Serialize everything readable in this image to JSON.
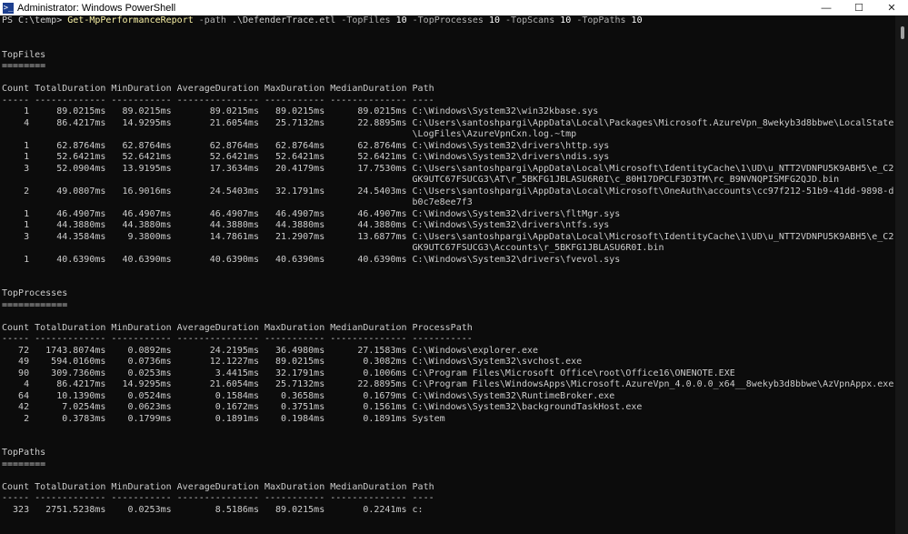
{
  "window": {
    "title": "Administrator: Windows PowerShell",
    "icon": "powershell-icon",
    "controls": {
      "minimize": "—",
      "maximize": "☐",
      "close": "✕"
    }
  },
  "prompt": {
    "path": "PS C:\\temp>",
    "command": "Get-MpPerformanceReport",
    "args": [
      {
        "param": "-path",
        "value": ".\\DefenderTrace.etl"
      },
      {
        "param": "-TopFiles",
        "value": "10"
      },
      {
        "param": "-TopProcesses",
        "value": "10"
      },
      {
        "param": "-TopScans",
        "value": "10"
      },
      {
        "param": "-TopPaths",
        "value": "10"
      }
    ]
  },
  "lines": [
    "",
    "",
    "TopFiles",
    "========",
    "",
    "Count TotalDuration MinDuration AverageDuration MaxDuration MedianDuration Path",
    "----- ------------- ----------- --------------- ----------- -------------- ----",
    "    1     89.0215ms   89.0215ms       89.0215ms   89.0215ms      89.0215ms C:\\Windows\\System32\\win32kbase.sys",
    "    4     86.4217ms   14.9295ms       21.6054ms   25.7132ms      22.8895ms C:\\Users\\santoshpargi\\AppData\\Local\\Packages\\Microsoft.AzureVpn_8wekyb3d8bbwe\\LocalState",
    "                                                                           \\LogFiles\\AzureVpnCxn.log.~tmp",
    "    1     62.8764ms   62.8764ms       62.8764ms   62.8764ms      62.8764ms C:\\Windows\\System32\\drivers\\http.sys",
    "    1     52.6421ms   52.6421ms       52.6421ms   52.6421ms      52.6421ms C:\\Windows\\System32\\drivers\\ndis.sys",
    "    3     52.0904ms   13.9195ms       17.3634ms   20.4179ms      17.7530ms C:\\Users\\santoshpargi\\AppData\\Local\\Microsoft\\IdentityCache\\1\\UD\\u_NTT2VDNPU5K9ABH5\\e_C2",
    "                                                                           GK9UTC67FSUCG3\\AT\\r_5BKFG1JBLASU6R0I\\c_80H17DPCLF3D3TM\\rc_B9NVNQPISMFG2QJD.bin",
    "    2     49.0807ms   16.9016ms       24.5403ms   32.1791ms      24.5403ms C:\\Users\\santoshpargi\\AppData\\Local\\Microsoft\\OneAuth\\accounts\\cc97f212-51b9-41dd-9898-d",
    "                                                                           b0c7e8ee7f3",
    "    1     46.4907ms   46.4907ms       46.4907ms   46.4907ms      46.4907ms C:\\Windows\\System32\\drivers\\fltMgr.sys",
    "    1     44.3880ms   44.3880ms       44.3880ms   44.3880ms      44.3880ms C:\\Windows\\System32\\drivers\\ntfs.sys",
    "    3     44.3584ms    9.3800ms       14.7861ms   21.2907ms      13.6877ms C:\\Users\\santoshpargi\\AppData\\Local\\Microsoft\\IdentityCache\\1\\UD\\u_NTT2VDNPU5K9ABH5\\e_C2",
    "                                                                           GK9UTC67FSUCG3\\Accounts\\r_5BKFG1JBLASU6R0I.bin",
    "    1     40.6390ms   40.6390ms       40.6390ms   40.6390ms      40.6390ms C:\\Windows\\System32\\drivers\\fvevol.sys",
    "",
    "",
    "TopProcesses",
    "============",
    "",
    "Count TotalDuration MinDuration AverageDuration MaxDuration MedianDuration ProcessPath",
    "----- ------------- ----------- --------------- ----------- -------------- -----------",
    "   72   1743.8074ms    0.0892ms       24.2195ms   36.4980ms      27.1583ms C:\\Windows\\explorer.exe",
    "   49    594.0160ms    0.0736ms       12.1227ms   89.0215ms       0.3082ms C:\\Windows\\System32\\svchost.exe",
    "   90    309.7360ms    0.0253ms        3.4415ms   32.1791ms       0.1006ms C:\\Program Files\\Microsoft Office\\root\\Office16\\ONENOTE.EXE",
    "    4     86.4217ms   14.9295ms       21.6054ms   25.7132ms      22.8895ms C:\\Program Files\\WindowsApps\\Microsoft.AzureVpn_4.0.0.0_x64__8wekyb3d8bbwe\\AzVpnAppx.exe",
    "   64     10.1390ms    0.0524ms        0.1584ms    0.3658ms       0.1679ms C:\\Windows\\System32\\RuntimeBroker.exe",
    "   42      7.0254ms    0.0623ms        0.1672ms    0.3751ms       0.1561ms C:\\Windows\\System32\\backgroundTaskHost.exe",
    "    2      0.3783ms    0.1799ms        0.1891ms    0.1984ms       0.1891ms System",
    "",
    "",
    "TopPaths",
    "========",
    "",
    "Count TotalDuration MinDuration AverageDuration MaxDuration MedianDuration Path",
    "----- ------------- ----------- --------------- ----------- -------------- ----",
    "  323   2751.5238ms    0.0253ms        8.5186ms   89.0215ms       0.2241ms c:"
  ]
}
